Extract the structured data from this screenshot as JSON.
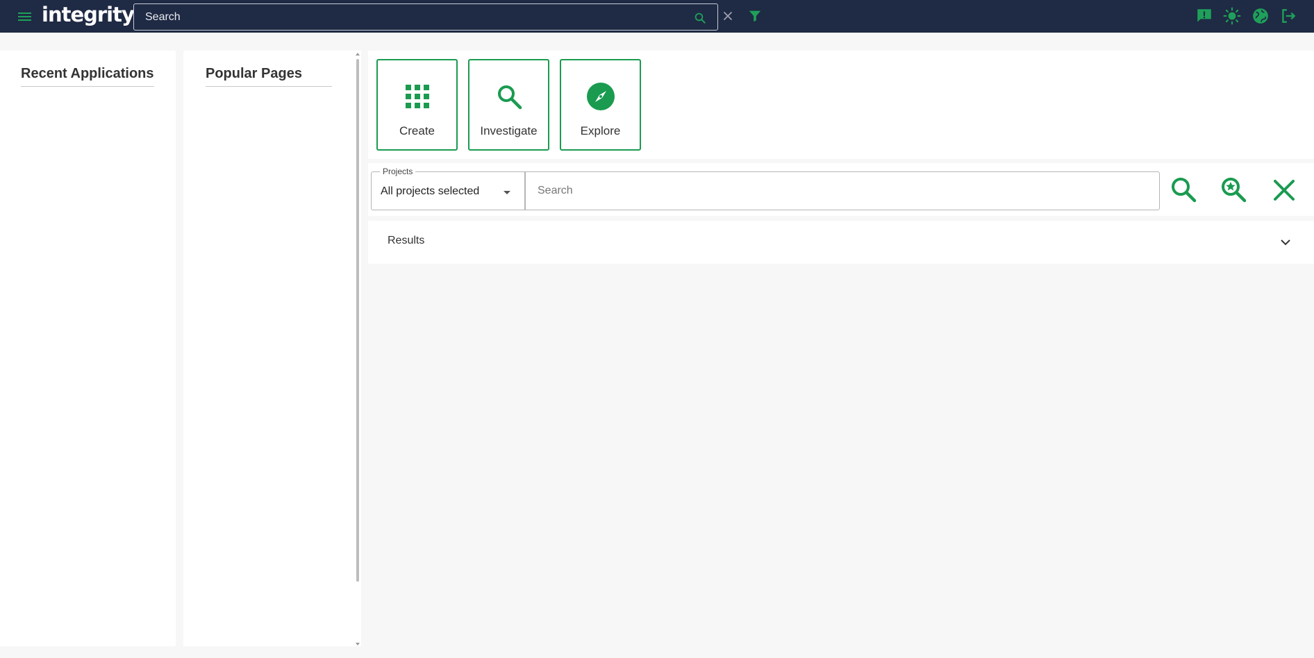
{
  "app": {
    "logo_text": "integrity",
    "accent_color": "#1a9b50",
    "topbar_color": "#1f2a44"
  },
  "topbar": {
    "search_placeholder": "Search",
    "icons": [
      "menu-icon",
      "search-icon",
      "close-icon",
      "filter-icon",
      "feedback-icon",
      "theme-sun-icon",
      "globe-icon",
      "logout-icon"
    ]
  },
  "sidebar": {
    "recent_title": "Recent Applications",
    "popular_title": "Popular Pages"
  },
  "tiles": [
    {
      "label": "Create",
      "icon": "grid-icon"
    },
    {
      "label": "Investigate",
      "icon": "search-icon"
    },
    {
      "label": "Explore",
      "icon": "compass-icon"
    }
  ],
  "search_panel": {
    "projects_label": "Projects",
    "projects_value": "All projects selected",
    "search_placeholder": "Search",
    "actions": [
      "search-icon",
      "advanced-search-icon",
      "clear-icon"
    ]
  },
  "results": {
    "label": "Results",
    "expanded": false
  }
}
